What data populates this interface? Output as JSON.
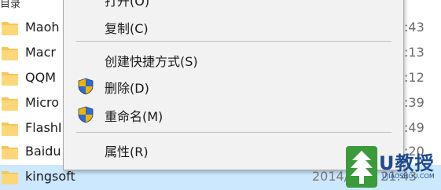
{
  "file_list": {
    "top_partial": "目录",
    "rows": [
      {
        "name": "Maoh",
        "time_suffix": ":43",
        "date": ""
      },
      {
        "name": "Macr",
        "time_suffix": ":13",
        "date": ""
      },
      {
        "name": "QQM",
        "time_suffix": ":12",
        "date": ""
      },
      {
        "name": "Micro",
        "time_suffix": ":39",
        "date": ""
      },
      {
        "name": "FlashI",
        "time_suffix": ":49",
        "date": ""
      },
      {
        "name": "Baidu",
        "time_suffix": ":20",
        "date": ""
      },
      {
        "name": "kingsoft",
        "time_suffix": "",
        "date": "2014/4/28 21:43"
      }
    ]
  },
  "context_menu": {
    "items": [
      {
        "label": "打开(O)"
      },
      {
        "label": "复制(C)"
      },
      {
        "label": "创建快捷方式(S)"
      },
      {
        "label": "删除(D)",
        "icon": "uac-shield-icon"
      },
      {
        "label": "重命名(M)",
        "icon": "uac-shield-icon"
      },
      {
        "label": "属性(R)"
      }
    ]
  },
  "watermark": {
    "word": "U教授",
    "url": "UJIAOSHOU.COM"
  },
  "colors": {
    "menu_bg": "#f2f2f2",
    "selected_row": "#cce8ff",
    "folder": "#f5c65a",
    "shield_blue": "#2d6bd3",
    "shield_yellow": "#f0b400",
    "watermark_green": "#3b9a3a",
    "watermark_blue": "#1d4a92"
  }
}
